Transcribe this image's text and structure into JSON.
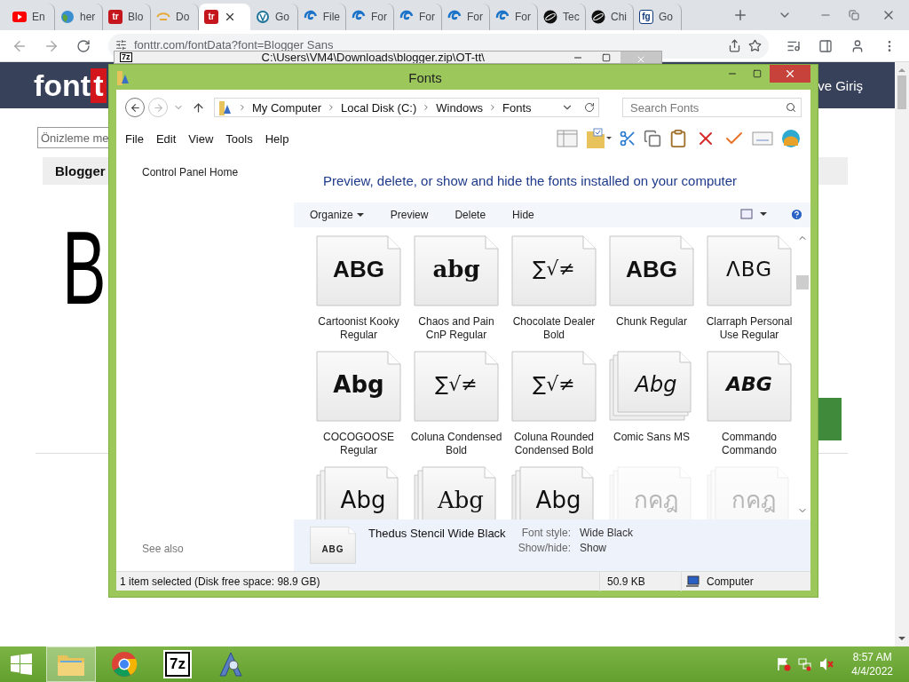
{
  "browser": {
    "tabs": [
      {
        "title": "En",
        "kind": "video",
        "selected": false
      },
      {
        "title": "her",
        "kind": "globe",
        "selected": false
      },
      {
        "title": "Blo",
        "kind": "badge",
        "badge": "tr",
        "selected": false
      },
      {
        "title": "Do",
        "kind": "bulb",
        "selected": false
      },
      {
        "kind": "badge",
        "badge": "tr",
        "selected": true
      },
      {
        "title": "Go",
        "kind": "wp",
        "selected": false
      },
      {
        "title": "File",
        "kind": "swirl",
        "selected": false
      },
      {
        "title": "For",
        "kind": "swirl",
        "selected": false
      },
      {
        "title": "For",
        "kind": "swirl",
        "selected": false
      },
      {
        "title": "For",
        "kind": "swirl",
        "selected": false
      },
      {
        "title": "For",
        "kind": "swirl",
        "selected": false
      },
      {
        "title": "Tec",
        "kind": "planet",
        "selected": false
      },
      {
        "title": "Chi",
        "kind": "planet",
        "selected": false
      },
      {
        "title": "Go",
        "kind": "badge",
        "badge": "fg",
        "selected": false
      }
    ],
    "address": "fonttr.com/fontData?font=Blogger Sans"
  },
  "page": {
    "logo": "font",
    "logo_mark": "t",
    "login": "ve Giriş",
    "preview_placeholder": "Önizleme me",
    "font_tab": "Blogger",
    "sample": "B"
  },
  "archive_window": {
    "badge": "7z",
    "title": "C:\\Users\\VM4\\Downloads\\blogger.zip\\OT-tt\\"
  },
  "explorer": {
    "title": "Fonts",
    "breadcrumb": [
      "My Computer",
      "Local Disk (C:)",
      "Windows",
      "Fonts"
    ],
    "search_placeholder": "Search Fonts",
    "menu": [
      "File",
      "Edit",
      "View",
      "Tools",
      "Help"
    ],
    "left_links": [
      "Control Panel Home"
    ],
    "see_also": "See also",
    "heading": "Preview, delete, or show and hide the fonts installed on your computer",
    "commands": [
      {
        "label": "Organize",
        "kind": "menu"
      },
      {
        "label": "Preview",
        "kind": "plain"
      },
      {
        "label": "Delete",
        "kind": "plain"
      },
      {
        "label": "Hide",
        "kind": "plain"
      }
    ],
    "fonts": [
      {
        "name": "Cartoonist Kooky Regular",
        "sample": "ABG",
        "kind": "heavy",
        "stacked": false,
        "hidden": false
      },
      {
        "name": "Chaos and Pain CnP Regular",
        "sample": "abg",
        "kind": "blackletter",
        "stacked": false,
        "hidden": false
      },
      {
        "name": "Chocolate Dealer Bold",
        "sample": "∑√≠",
        "kind": "symbol",
        "stacked": false,
        "hidden": false
      },
      {
        "name": "Chunk Regular",
        "sample": "ABG",
        "kind": "heavy",
        "stacked": false,
        "hidden": false
      },
      {
        "name": "Clarraph Personal Use Regular",
        "sample": "ΛBG",
        "kind": "wide",
        "stacked": false,
        "hidden": false
      },
      {
        "name": "COCOGOOSE Regular",
        "sample": "Abg",
        "kind": "bold",
        "stacked": false,
        "hidden": false
      },
      {
        "name": "Coluna Condensed Bold",
        "sample": "∑√≠",
        "kind": "symbol",
        "stacked": false,
        "hidden": false
      },
      {
        "name": "Coluna Rounded Condensed Bold",
        "sample": "∑√≠",
        "kind": "symbol",
        "stacked": false,
        "hidden": false
      },
      {
        "name": "Comic Sans MS",
        "sample": "Abg",
        "kind": "casual",
        "stacked": true,
        "hidden": false
      },
      {
        "name": "Commando Commando",
        "sample": "ABG",
        "kind": "italic",
        "stacked": false,
        "hidden": false
      },
      {
        "sample": "Abg",
        "kind": "plain",
        "stacked": true,
        "hidden": false
      },
      {
        "sample": "Abg",
        "kind": "serif",
        "stacked": true,
        "hidden": false
      },
      {
        "sample": "Abg",
        "kind": "plain",
        "stacked": true,
        "hidden": false
      },
      {
        "sample": "กคฎ",
        "kind": "plain",
        "stacked": true,
        "hidden": true
      },
      {
        "sample": "กคฎ",
        "kind": "plain",
        "stacked": true,
        "hidden": true
      }
    ],
    "details": {
      "sample": "ABG",
      "name": "Thedus Stencil Wide Black",
      "fields": [
        {
          "label": "Font style:",
          "value": "Wide Black"
        },
        {
          "label": "Show/hide:",
          "value": "Show"
        }
      ]
    },
    "status": {
      "selection": "1 item selected (Disk free space: 98.9 GB)",
      "size": "50.9 KB",
      "zone": "Computer"
    }
  },
  "taskbar": {
    "items": [
      {
        "kind": "explorer",
        "selected": true
      },
      {
        "kind": "chrome",
        "selected": false
      },
      {
        "kind": "sevenzip",
        "badge": "7z",
        "selected": false
      },
      {
        "kind": "fontviewer",
        "selected": false
      }
    ],
    "time": "8:57 AM",
    "date": "4/4/2022"
  }
}
